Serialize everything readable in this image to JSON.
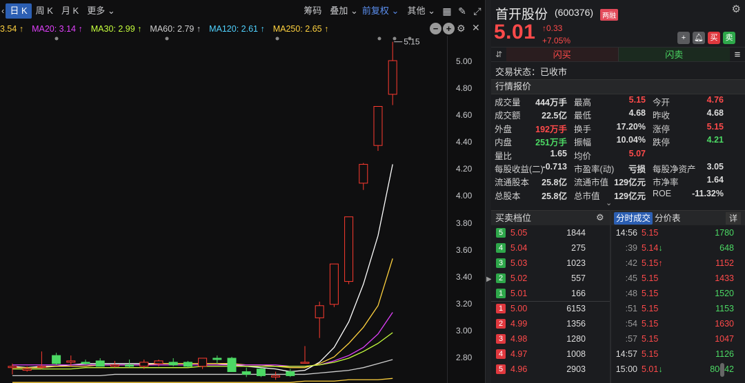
{
  "toolbar": {
    "periods": [
      "日 K",
      "周 K",
      "月 K"
    ],
    "more": "更多",
    "chips": "筹码",
    "overlay": "叠加",
    "adjust": "前复权",
    "other": "其他"
  },
  "ma_bar": [
    {
      "label": "3.54",
      "color": "#ffd23f"
    },
    {
      "label": "MA20: 3.14",
      "color": "#e040fb"
    },
    {
      "label": "MA30: 2.99",
      "color": "#c6ff3d"
    },
    {
      "label": "MA60: 2.79",
      "color": "#cfcfcf"
    },
    {
      "label": "MA120: 2.61",
      "color": "#4fd2ff"
    },
    {
      "label": "MA250: 2.65",
      "color": "#ffd23f"
    }
  ],
  "chart_data": {
    "type": "candlestick",
    "price_ticks": [
      "5.00",
      "4.80",
      "4.60",
      "4.40",
      "4.20",
      "4.00",
      "3.80",
      "3.60",
      "3.40",
      "3.20",
      "3.00",
      "2.80"
    ],
    "ylim": [
      2.7,
      5.2
    ],
    "high_label": "5.15",
    "up_color": "#ff3b30",
    "down_color": "#4cd964",
    "candles": [
      {
        "o": 2.73,
        "h": 2.76,
        "l": 2.68,
        "c": 2.74
      },
      {
        "o": 2.71,
        "h": 2.74,
        "l": 2.7,
        "c": 2.72
      },
      {
        "o": 2.74,
        "h": 2.85,
        "l": 2.72,
        "c": 2.74
      },
      {
        "o": 2.82,
        "h": 2.84,
        "l": 2.75,
        "c": 2.76
      },
      {
        "o": 2.77,
        "h": 2.82,
        "l": 2.74,
        "c": 2.78
      },
      {
        "o": 2.77,
        "h": 2.79,
        "l": 2.75,
        "c": 2.76
      },
      {
        "o": 2.78,
        "h": 2.8,
        "l": 2.74,
        "c": 2.74
      },
      {
        "o": 2.74,
        "h": 2.78,
        "l": 2.73,
        "c": 2.75
      },
      {
        "o": 2.75,
        "h": 2.79,
        "l": 2.73,
        "c": 2.74
      },
      {
        "o": 2.74,
        "h": 2.79,
        "l": 2.72,
        "c": 2.77
      },
      {
        "o": 2.76,
        "h": 2.79,
        "l": 2.74,
        "c": 2.78
      },
      {
        "o": 2.77,
        "h": 2.8,
        "l": 2.74,
        "c": 2.75
      },
      {
        "o": 2.77,
        "h": 2.78,
        "l": 2.73,
        "c": 2.74
      },
      {
        "o": 2.74,
        "h": 2.79,
        "l": 2.72,
        "c": 2.8
      },
      {
        "o": 2.8,
        "h": 2.82,
        "l": 2.76,
        "c": 2.79
      },
      {
        "o": 2.8,
        "h": 2.81,
        "l": 2.7,
        "c": 2.7
      },
      {
        "o": 2.7,
        "h": 2.73,
        "l": 2.66,
        "c": 2.68
      },
      {
        "o": 2.72,
        "h": 2.73,
        "l": 2.66,
        "c": 2.67
      },
      {
        "o": 2.66,
        "h": 2.7,
        "l": 2.64,
        "c": 2.67
      },
      {
        "o": 2.7,
        "h": 2.72,
        "l": 2.66,
        "c": 2.67
      },
      {
        "o": 2.77,
        "h": 2.89,
        "l": 2.76,
        "c": 2.77
      },
      {
        "o": 3.1,
        "h": 3.22,
        "l": 2.95,
        "c": 3.19
      },
      {
        "o": 3.2,
        "h": 3.5,
        "l": 3.18,
        "c": 3.5
      },
      {
        "o": 3.37,
        "h": 3.85,
        "l": 3.35,
        "c": 3.85
      },
      {
        "o": 4.1,
        "h": 4.25,
        "l": 4.05,
        "c": 4.24
      },
      {
        "o": 4.38,
        "h": 4.67,
        "l": 4.34,
        "c": 4.67
      },
      {
        "o": 4.76,
        "h": 5.15,
        "l": 4.68,
        "c": 5.01
      }
    ],
    "ma_lines": [
      {
        "name": "MA5",
        "color": "#ffffff",
        "values": [
          2.74,
          2.73,
          2.74,
          2.74,
          2.75,
          2.76,
          2.76,
          2.76,
          2.76,
          2.76,
          2.76,
          2.76,
          2.76,
          2.76,
          2.76,
          2.75,
          2.74,
          2.73,
          2.72,
          2.7,
          2.71,
          2.77,
          2.88,
          3.07,
          3.35,
          3.71,
          4.24
        ]
      },
      {
        "name": "MA10",
        "color": "#ffd23f",
        "values": [
          2.73,
          2.73,
          2.73,
          2.74,
          2.74,
          2.74,
          2.75,
          2.75,
          2.75,
          2.75,
          2.76,
          2.76,
          2.76,
          2.76,
          2.76,
          2.76,
          2.75,
          2.75,
          2.74,
          2.73,
          2.73,
          2.76,
          2.81,
          2.91,
          3.03,
          3.19,
          3.54
        ]
      },
      {
        "name": "MA20",
        "color": "#e040fb",
        "values": [
          2.75,
          2.75,
          2.75,
          2.75,
          2.75,
          2.75,
          2.75,
          2.75,
          2.75,
          2.75,
          2.75,
          2.75,
          2.75,
          2.75,
          2.75,
          2.75,
          2.75,
          2.75,
          2.75,
          2.74,
          2.74,
          2.75,
          2.78,
          2.82,
          2.88,
          2.98,
          3.14
        ]
      },
      {
        "name": "MA30",
        "color": "#c6ff3d",
        "values": [
          2.72,
          2.72,
          2.72,
          2.72,
          2.72,
          2.73,
          2.73,
          2.73,
          2.73,
          2.73,
          2.73,
          2.73,
          2.73,
          2.74,
          2.74,
          2.74,
          2.74,
          2.74,
          2.74,
          2.74,
          2.74,
          2.75,
          2.77,
          2.8,
          2.85,
          2.91,
          2.99
        ]
      },
      {
        "name": "MA60",
        "color": "#cfcfcf",
        "values": [
          2.67,
          2.67,
          2.67,
          2.67,
          2.67,
          2.67,
          2.67,
          2.68,
          2.68,
          2.68,
          2.68,
          2.68,
          2.68,
          2.68,
          2.68,
          2.68,
          2.68,
          2.68,
          2.68,
          2.68,
          2.68,
          2.69,
          2.7,
          2.71,
          2.73,
          2.76,
          2.79
        ]
      },
      {
        "name": "MA250",
        "color": "#ffd23f",
        "values": [
          2.62,
          2.62,
          2.62,
          2.62,
          2.62,
          2.62,
          2.62,
          2.62,
          2.62,
          2.62,
          2.62,
          2.62,
          2.62,
          2.62,
          2.62,
          2.62,
          2.62,
          2.62,
          2.62,
          2.62,
          2.63,
          2.63,
          2.63,
          2.64,
          2.64,
          2.64,
          2.65
        ]
      }
    ]
  },
  "stock": {
    "name": "首开股份",
    "code": "(600376)",
    "badge": "两融",
    "price": "5.01",
    "change": "0.33",
    "change_pct": "+7.05%",
    "buy_btn": "买",
    "sell_btn": "卖",
    "add_btn": "+"
  },
  "flash": {
    "buy": "闪买",
    "sell": "闪卖"
  },
  "trade_status": "交易状态：已收市",
  "quote_title": "行情报价",
  "quotes": [
    [
      {
        "l": "成交量",
        "v": "444万手",
        "c": ""
      },
      {
        "l": "最高",
        "v": "5.15",
        "c": "red"
      },
      {
        "l": "今开",
        "v": "4.76",
        "c": "red"
      }
    ],
    [
      {
        "l": "成交额",
        "v": "22.5亿",
        "c": ""
      },
      {
        "l": "最低",
        "v": "4.68",
        "c": ""
      },
      {
        "l": "昨收",
        "v": "4.68",
        "c": ""
      }
    ],
    [
      {
        "l": "外盘",
        "v": "192万手",
        "c": "red"
      },
      {
        "l": "换手",
        "v": "17.20%",
        "c": ""
      },
      {
        "l": "涨停",
        "v": "5.15",
        "c": "red"
      }
    ],
    [
      {
        "l": "内盘",
        "v": "251万手",
        "c": "green"
      },
      {
        "l": "振幅",
        "v": "10.04%",
        "c": ""
      },
      {
        "l": "跌停",
        "v": "4.21",
        "c": "green"
      }
    ],
    [
      {
        "l": "量比",
        "v": "1.65",
        "c": ""
      },
      {
        "l": "均价",
        "v": "5.07",
        "c": "red"
      },
      {
        "l": "",
        "v": "",
        "c": ""
      }
    ],
    [
      {
        "l": "每股收益(二)",
        "v": "-0.713",
        "c": ""
      },
      {
        "l": "市盈率(动)",
        "v": "亏损",
        "c": ""
      },
      {
        "l": "每股净资产",
        "v": "3.05",
        "c": ""
      }
    ],
    [
      {
        "l": "流通股本",
        "v": "25.8亿",
        "c": ""
      },
      {
        "l": "流通市值",
        "v": "129亿元",
        "c": ""
      },
      {
        "l": "市净率",
        "v": "1.64",
        "c": ""
      }
    ],
    [
      {
        "l": "总股本",
        "v": "25.8亿",
        "c": ""
      },
      {
        "l": "总市值",
        "v": "129亿元",
        "c": ""
      },
      {
        "l": "ROE",
        "v": "-11.32%",
        "c": ""
      }
    ]
  ],
  "orderbook_title": "买卖档位",
  "asks": [
    {
      "lvl": "5",
      "price": "5.05",
      "vol": "1844"
    },
    {
      "lvl": "4",
      "price": "5.04",
      "vol": "275"
    },
    {
      "lvl": "3",
      "price": "5.03",
      "vol": "1023"
    },
    {
      "lvl": "2",
      "price": "5.02",
      "vol": "557"
    },
    {
      "lvl": "1",
      "price": "5.01",
      "vol": "166"
    }
  ],
  "bids": [
    {
      "lvl": "1",
      "price": "5.00",
      "vol": "6153"
    },
    {
      "lvl": "2",
      "price": "4.99",
      "vol": "1356"
    },
    {
      "lvl": "3",
      "price": "4.98",
      "vol": "1280"
    },
    {
      "lvl": "4",
      "price": "4.97",
      "vol": "1008"
    },
    {
      "lvl": "5",
      "price": "4.96",
      "vol": "2903"
    }
  ],
  "tick_tabs": {
    "time_sales": "分时成交",
    "price_table": "分价表",
    "detail": "详"
  },
  "ticks": [
    {
      "t": "14:56",
      "sub": false,
      "p": "5.15",
      "pc": "red",
      "arrow": "",
      "v": "1780",
      "vc": "green"
    },
    {
      "t": ":39",
      "sub": true,
      "p": "5.14",
      "pc": "red",
      "arrow": "↓",
      "v": "648",
      "vc": "green"
    },
    {
      "t": ":42",
      "sub": true,
      "p": "5.15",
      "pc": "red",
      "arrow": "↑",
      "v": "1152",
      "vc": "red"
    },
    {
      "t": ":45",
      "sub": true,
      "p": "5.15",
      "pc": "red",
      "arrow": "",
      "v": "1433",
      "vc": "red"
    },
    {
      "t": ":48",
      "sub": true,
      "p": "5.15",
      "pc": "red",
      "arrow": "",
      "v": "1520",
      "vc": "green"
    },
    {
      "t": ":51",
      "sub": true,
      "p": "5.15",
      "pc": "red",
      "arrow": "",
      "v": "1153",
      "vc": "green"
    },
    {
      "t": ":54",
      "sub": true,
      "p": "5.15",
      "pc": "red",
      "arrow": "",
      "v": "1630",
      "vc": "red"
    },
    {
      "t": ":57",
      "sub": true,
      "p": "5.15",
      "pc": "red",
      "arrow": "",
      "v": "1047",
      "vc": "red"
    },
    {
      "t": "14:57",
      "sub": false,
      "p": "5.15",
      "pc": "red",
      "arrow": "",
      "v": "1126",
      "vc": "green"
    },
    {
      "t": "15:00",
      "sub": false,
      "p": "5.01",
      "pc": "red",
      "arrow": "↓",
      "v": "80042",
      "vc": "green"
    }
  ]
}
